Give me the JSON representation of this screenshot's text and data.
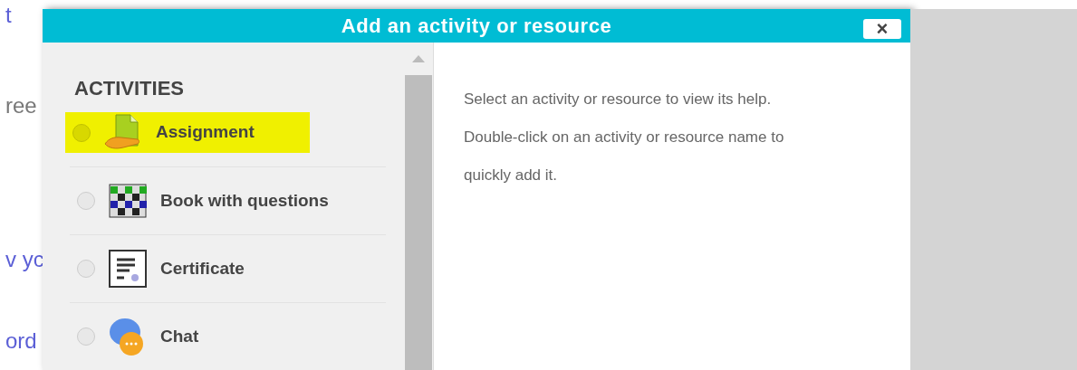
{
  "background_page": {
    "fragments": [
      {
        "text": "t",
        "kind": "link"
      },
      {
        "text": "ree",
        "kind": "text"
      },
      {
        "text": "v yc",
        "kind": "link"
      },
      {
        "text": "ord",
        "kind": "link"
      }
    ]
  },
  "dialog": {
    "title": "Add an activity or resource",
    "close_label": "×",
    "section_heading": "ACTIVITIES",
    "items": [
      {
        "label": "Assignment",
        "kind": "assignment",
        "selected": false,
        "highlighted": true
      },
      {
        "label": "Book with questions",
        "kind": "book",
        "selected": false,
        "highlighted": false
      },
      {
        "label": "Certificate",
        "kind": "certificate",
        "selected": false,
        "highlighted": false
      },
      {
        "label": "Chat",
        "kind": "chat",
        "selected": false,
        "highlighted": false
      }
    ],
    "help_lines": [
      "Select an activity or resource to view its help.",
      "Double-click on an activity or resource name to",
      "quickly add it."
    ]
  }
}
